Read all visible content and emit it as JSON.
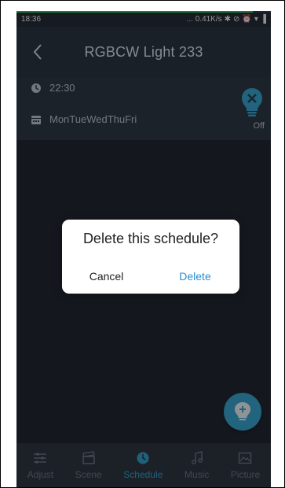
{
  "status_bar": {
    "time": "18:36",
    "speed": "... 0.41K/s",
    "icons": [
      "bluetooth-icon",
      "mute-icon",
      "alarm-icon",
      "wifi-icon",
      "signal-icon"
    ],
    "load_fraction": 0.93
  },
  "header": {
    "title": "RGBCW Light 233"
  },
  "schedule": {
    "time": "22:30",
    "days": "MonTueWedThuFri",
    "state": "Off"
  },
  "dialog": {
    "message": "Delete this schedule?",
    "cancel_label": "Cancel",
    "delete_label": "Delete"
  },
  "tabs": [
    {
      "label": "Adjust",
      "icon": "sliders-icon",
      "active": false
    },
    {
      "label": "Scene",
      "icon": "clapperboard-icon",
      "active": false
    },
    {
      "label": "Schedule",
      "icon": "clock-icon",
      "active": true
    },
    {
      "label": "Music",
      "icon": "music-icon",
      "active": false
    },
    {
      "label": "Picture",
      "icon": "picture-icon",
      "active": false
    }
  ],
  "colors": {
    "accent": "#2ea6d6",
    "background": "#232a33",
    "dialog_delete": "#2a8ed0"
  }
}
